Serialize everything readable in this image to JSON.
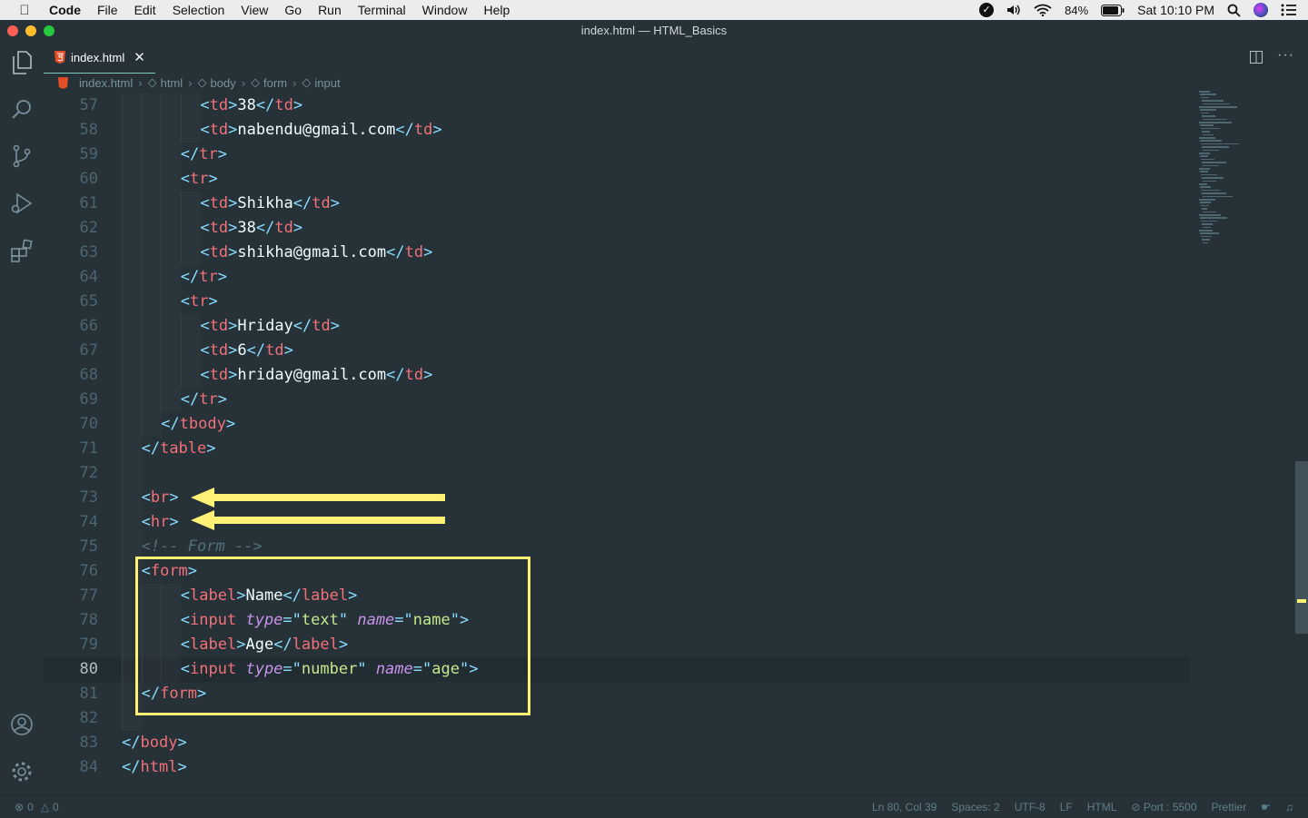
{
  "menubar": {
    "app": "Code",
    "items": [
      "File",
      "Edit",
      "Selection",
      "View",
      "Go",
      "Run",
      "Terminal",
      "Window",
      "Help"
    ],
    "battery": "84%",
    "clock": "Sat 10:10 PM"
  },
  "window": {
    "title": "index.html — HTML_Basics"
  },
  "tab": {
    "label": "index.html"
  },
  "breadcrumbs": [
    "index.html",
    "html",
    "body",
    "form",
    "input"
  ],
  "editor": {
    "lines": [
      {
        "n": "57",
        "tokens": [
          [
            "t",
            "    "
          ],
          [
            "p",
            "<"
          ],
          [
            "t",
            "td"
          ],
          [
            "p",
            ">"
          ],
          [
            "x",
            "38"
          ],
          [
            "p",
            "</"
          ],
          [
            "t",
            "td"
          ],
          [
            "p",
            ">"
          ]
        ],
        "indent": 4
      },
      {
        "n": "58",
        "tokens": [
          [
            "p",
            "<"
          ],
          [
            "t",
            "td"
          ],
          [
            "p",
            ">"
          ],
          [
            "x",
            "nabendu@gmail.com"
          ],
          [
            "p",
            "</"
          ],
          [
            "t",
            "td"
          ],
          [
            "p",
            ">"
          ]
        ],
        "indent": 4
      },
      {
        "n": "59",
        "tokens": [
          [
            "p",
            "</"
          ],
          [
            "t",
            "tr"
          ],
          [
            "p",
            ">"
          ]
        ],
        "indent": 3
      },
      {
        "n": "60",
        "tokens": [
          [
            "p",
            "<"
          ],
          [
            "t",
            "tr"
          ],
          [
            "p",
            ">"
          ]
        ],
        "indent": 3
      },
      {
        "n": "61",
        "tokens": [
          [
            "p",
            "<"
          ],
          [
            "t",
            "td"
          ],
          [
            "p",
            ">"
          ],
          [
            "x",
            "Shikha"
          ],
          [
            "p",
            "</"
          ],
          [
            "t",
            "td"
          ],
          [
            "p",
            ">"
          ]
        ],
        "indent": 4
      },
      {
        "n": "62",
        "tokens": [
          [
            "p",
            "<"
          ],
          [
            "t",
            "td"
          ],
          [
            "p",
            ">"
          ],
          [
            "x",
            "38"
          ],
          [
            "p",
            "</"
          ],
          [
            "t",
            "td"
          ],
          [
            "p",
            ">"
          ]
        ],
        "indent": 4
      },
      {
        "n": "63",
        "tokens": [
          [
            "p",
            "<"
          ],
          [
            "t",
            "td"
          ],
          [
            "p",
            ">"
          ],
          [
            "x",
            "shikha@gmail.com"
          ],
          [
            "p",
            "</"
          ],
          [
            "t",
            "td"
          ],
          [
            "p",
            ">"
          ]
        ],
        "indent": 4
      },
      {
        "n": "64",
        "tokens": [
          [
            "p",
            "</"
          ],
          [
            "t",
            "tr"
          ],
          [
            "p",
            ">"
          ]
        ],
        "indent": 3
      },
      {
        "n": "65",
        "tokens": [
          [
            "p",
            "<"
          ],
          [
            "t",
            "tr"
          ],
          [
            "p",
            ">"
          ]
        ],
        "indent": 3
      },
      {
        "n": "66",
        "tokens": [
          [
            "p",
            "<"
          ],
          [
            "t",
            "td"
          ],
          [
            "p",
            ">"
          ],
          [
            "x",
            "Hriday"
          ],
          [
            "p",
            "</"
          ],
          [
            "t",
            "td"
          ],
          [
            "p",
            ">"
          ]
        ],
        "indent": 4
      },
      {
        "n": "67",
        "tokens": [
          [
            "p",
            "<"
          ],
          [
            "t",
            "td"
          ],
          [
            "p",
            ">"
          ],
          [
            "x",
            "6"
          ],
          [
            "p",
            "</"
          ],
          [
            "t",
            "td"
          ],
          [
            "p",
            ">"
          ]
        ],
        "indent": 4
      },
      {
        "n": "68",
        "tokens": [
          [
            "p",
            "<"
          ],
          [
            "t",
            "td"
          ],
          [
            "p",
            ">"
          ],
          [
            "x",
            "hriday@gmail.com"
          ],
          [
            "p",
            "</"
          ],
          [
            "t",
            "td"
          ],
          [
            "p",
            ">"
          ]
        ],
        "indent": 4
      },
      {
        "n": "69",
        "tokens": [
          [
            "p",
            "</"
          ],
          [
            "t",
            "tr"
          ],
          [
            "p",
            ">"
          ]
        ],
        "indent": 3
      },
      {
        "n": "70",
        "tokens": [
          [
            "p",
            "</"
          ],
          [
            "t",
            "tbody"
          ],
          [
            "p",
            ">"
          ]
        ],
        "indent": 2
      },
      {
        "n": "71",
        "tokens": [
          [
            "p",
            "</"
          ],
          [
            "t",
            "table"
          ],
          [
            "p",
            ">"
          ]
        ],
        "indent": 1
      },
      {
        "n": "72",
        "tokens": [],
        "indent": 1
      },
      {
        "n": "73",
        "tokens": [
          [
            "p",
            "<"
          ],
          [
            "t",
            "br"
          ],
          [
            "p",
            ">"
          ]
        ],
        "indent": 1
      },
      {
        "n": "74",
        "tokens": [
          [
            "p",
            "<"
          ],
          [
            "t",
            "hr"
          ],
          [
            "p",
            ">"
          ]
        ],
        "indent": 1
      },
      {
        "n": "75",
        "tokens": [
          [
            "c",
            "<!-- Form -->"
          ]
        ],
        "indent": 1
      },
      {
        "n": "76",
        "tokens": [
          [
            "p",
            "<"
          ],
          [
            "t",
            "form"
          ],
          [
            "p",
            ">"
          ]
        ],
        "indent": 1
      },
      {
        "n": "77",
        "tokens": [
          [
            "p",
            "<"
          ],
          [
            "t",
            "label"
          ],
          [
            "p",
            ">"
          ],
          [
            "x",
            "Name"
          ],
          [
            "p",
            "</"
          ],
          [
            "t",
            "label"
          ],
          [
            "p",
            ">"
          ]
        ],
        "indent": 3
      },
      {
        "n": "78",
        "tokens": [
          [
            "p",
            "<"
          ],
          [
            "t",
            "input "
          ],
          [
            "a",
            "type"
          ],
          [
            "p",
            "=\""
          ],
          [
            "s",
            "text"
          ],
          [
            "p",
            "\" "
          ],
          [
            "a",
            "name"
          ],
          [
            "p",
            "=\""
          ],
          [
            "s",
            "name"
          ],
          [
            "p",
            "\">"
          ]
        ],
        "indent": 3
      },
      {
        "n": "79",
        "tokens": [
          [
            "p",
            "<"
          ],
          [
            "t",
            "label"
          ],
          [
            "p",
            ">"
          ],
          [
            "x",
            "Age"
          ],
          [
            "p",
            "</"
          ],
          [
            "t",
            "label"
          ],
          [
            "p",
            ">"
          ]
        ],
        "indent": 3
      },
      {
        "n": "80",
        "tokens": [
          [
            "p",
            "<"
          ],
          [
            "t",
            "input "
          ],
          [
            "a",
            "type"
          ],
          [
            "p",
            "=\""
          ],
          [
            "s",
            "number"
          ],
          [
            "p",
            "\" "
          ],
          [
            "a",
            "name"
          ],
          [
            "p",
            "=\""
          ],
          [
            "s",
            "age"
          ],
          [
            "p",
            "\">"
          ]
        ],
        "indent": 3,
        "active": true
      },
      {
        "n": "81",
        "tokens": [
          [
            "p",
            "</"
          ],
          [
            "t",
            "form"
          ],
          [
            "p",
            ">"
          ]
        ],
        "indent": 1
      },
      {
        "n": "82",
        "tokens": [],
        "indent": 1
      },
      {
        "n": "83",
        "tokens": [
          [
            "p",
            "</"
          ],
          [
            "t",
            "body"
          ],
          [
            "p",
            ">"
          ]
        ],
        "indent": 0
      },
      {
        "n": "84",
        "tokens": [
          [
            "p",
            "</"
          ],
          [
            "t",
            "html"
          ],
          [
            "p",
            ">"
          ]
        ],
        "indent": 0
      }
    ]
  },
  "status": {
    "errors": "0",
    "warnings": "0",
    "position": "Ln 80, Col 39",
    "spaces": "Spaces: 2",
    "encoding": "UTF-8",
    "eol": "LF",
    "language": "HTML",
    "port": "Port : 5500",
    "formatter": "Prettier"
  },
  "colors": {
    "annotation": "#fff176",
    "accent": "#80cbc4"
  }
}
